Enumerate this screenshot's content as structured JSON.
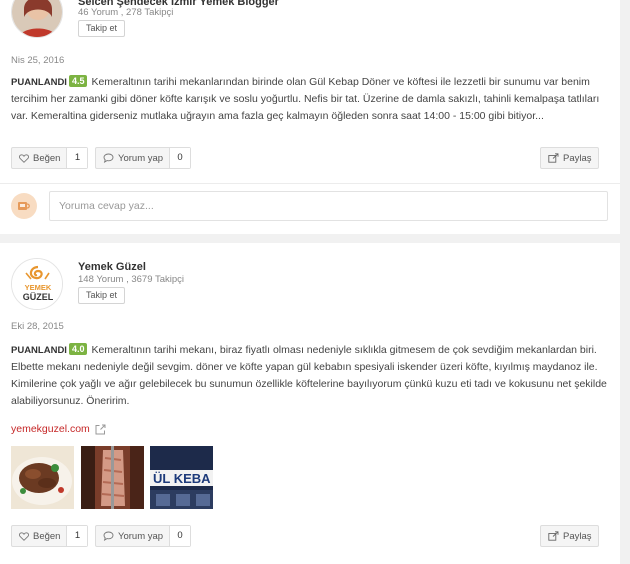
{
  "reviews": [
    {
      "user": {
        "name": "Selcen Şehdecek İzmir Yemek Blogger",
        "stats": "46 Yorum , 278 Takipçi",
        "follow_label": "Takip et"
      },
      "date": "Nis 25, 2016",
      "rating_label": "PUANLANDI",
      "score": "4.5",
      "text": "Kemeraltının tarihi mekanlarından birinde olan Gül Kebap Döner ve köftesi ile lezzetli bir sunumu var benim tercihim her zamanki gibi döner köfte karışık ve soslu yoğurtlu. Nefis bir tat. Üzerine de damla sakızlı, tahinli kemalpaşa tatlıları var. Kemeraltina giderseniz mutlaka uğrayın ama fazla geç kalmayın öğleden sonra saat 14:00 - 15:00 gibi bitiyor...",
      "actions": {
        "like_label": "Beğen",
        "like_count": "1",
        "comment_label": "Yorum yap",
        "comment_count": "0",
        "share_label": "Paylaş"
      },
      "reply_placeholder": "Yoruma cevap yaz..."
    },
    {
      "user": {
        "name": "Yemek Güzel",
        "stats": "148 Yorum , 3679 Takipçi",
        "follow_label": "Takip et",
        "logo_text_1": "YEMEK",
        "logo_text_2": "GÜZEL"
      },
      "date": "Eki 28, 2015",
      "rating_label": "PUANLANDI",
      "score": "4.0",
      "text": "Kemeraltının tarihi mekanı, biraz fiyatlı olması nedeniyle sıklıkla gitmesem de çok sevdiğim mekanlardan biri. Elbette mekanı nedeniyle değil sevgim. döner ve köfte yapan gül kebabın spesiyali iskender üzeri köfte, kıyılmış maydanoz ile. Kimilerine çok yağlı ve ağır gelebilecek bu sunumun özellikle köftelerine bayılıyorum çünkü kuzu eti tadı ve kokusunu net şekilde alabiliyorsunuz. Öneririm.",
      "link": "yemekguzel.com",
      "photo3_text": "ÜL KEBA",
      "actions": {
        "like_label": "Beğen",
        "like_count": "1",
        "comment_label": "Yorum yap",
        "comment_count": "0",
        "share_label": "Paylaş"
      }
    }
  ],
  "colors": {
    "score_bg": "#7cb342",
    "link": "#c62828",
    "page_bg": "#f1f1f1"
  },
  "icons": [
    "heart-icon",
    "comment-icon",
    "share-icon",
    "external-link-icon",
    "coffee-cup-icon"
  ]
}
